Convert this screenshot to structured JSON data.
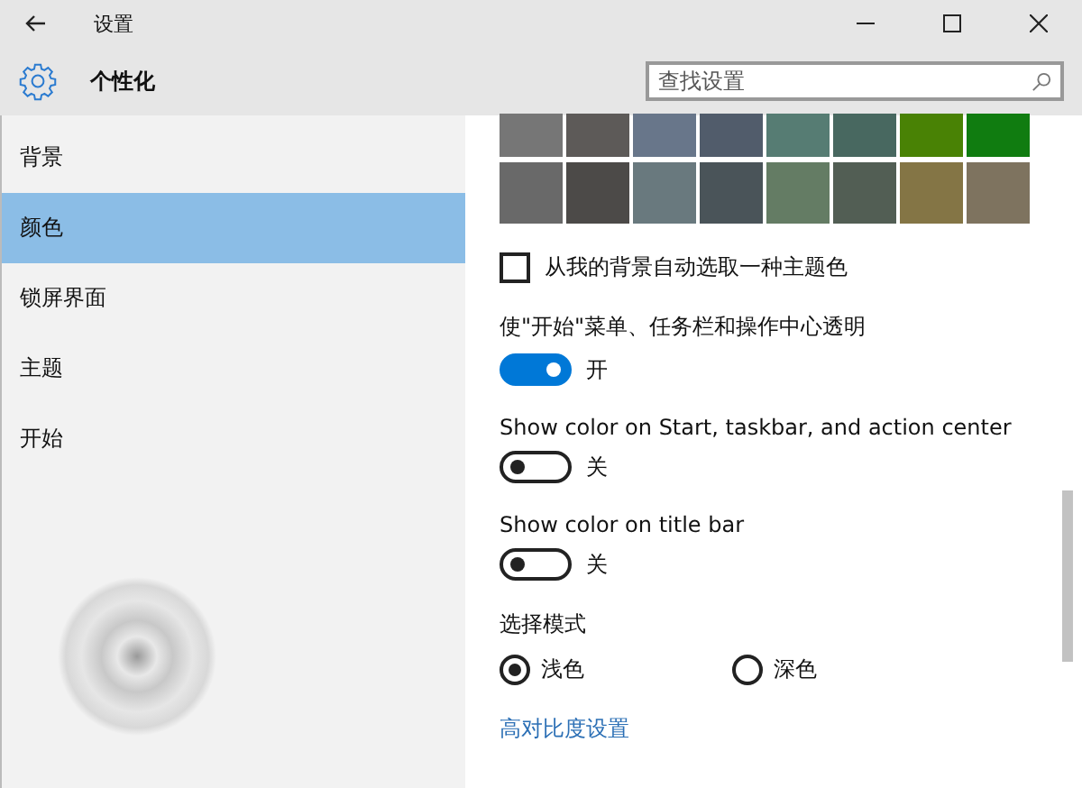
{
  "window": {
    "title": "设置"
  },
  "header": {
    "title": "个性化"
  },
  "search": {
    "placeholder": "查找设置"
  },
  "sidebar": {
    "items": [
      {
        "label": "背景",
        "selected": false
      },
      {
        "label": "颜色",
        "selected": true
      },
      {
        "label": "锁屏界面",
        "selected": false
      },
      {
        "label": "主题",
        "selected": false
      },
      {
        "label": "开始",
        "selected": false
      }
    ]
  },
  "swatches": [
    {
      "color": "#767676"
    },
    {
      "color": "#5d5a58"
    },
    {
      "color": "#68768a"
    },
    {
      "color": "#515c6b"
    },
    {
      "color": "#567c73"
    },
    {
      "color": "#486860"
    },
    {
      "color": "#498205"
    },
    {
      "color": "#107c10"
    },
    {
      "color": "#696969"
    },
    {
      "color": "#4c4a48"
    },
    {
      "color": "#69797e"
    },
    {
      "color": "#4a5459"
    },
    {
      "color": "#647c64"
    },
    {
      "color": "#525e54"
    },
    {
      "color": "#847545"
    },
    {
      "color": "#7e735f"
    }
  ],
  "auto_color": {
    "label": "从我的背景自动选取一种主题色",
    "checked": false
  },
  "toggles": [
    {
      "label": "使\"开始\"菜单、任务栏和操作中心透明",
      "on": true,
      "state_text": "开"
    },
    {
      "label": "Show color on Start, taskbar, and action center",
      "on": false,
      "state_text": "关"
    },
    {
      "label": "Show color on title bar",
      "on": false,
      "state_text": "关"
    }
  ],
  "mode": {
    "label": "选择模式",
    "options": [
      {
        "label": "浅色",
        "selected": true
      },
      {
        "label": "深色",
        "selected": false
      }
    ]
  },
  "link": "高对比度设置"
}
